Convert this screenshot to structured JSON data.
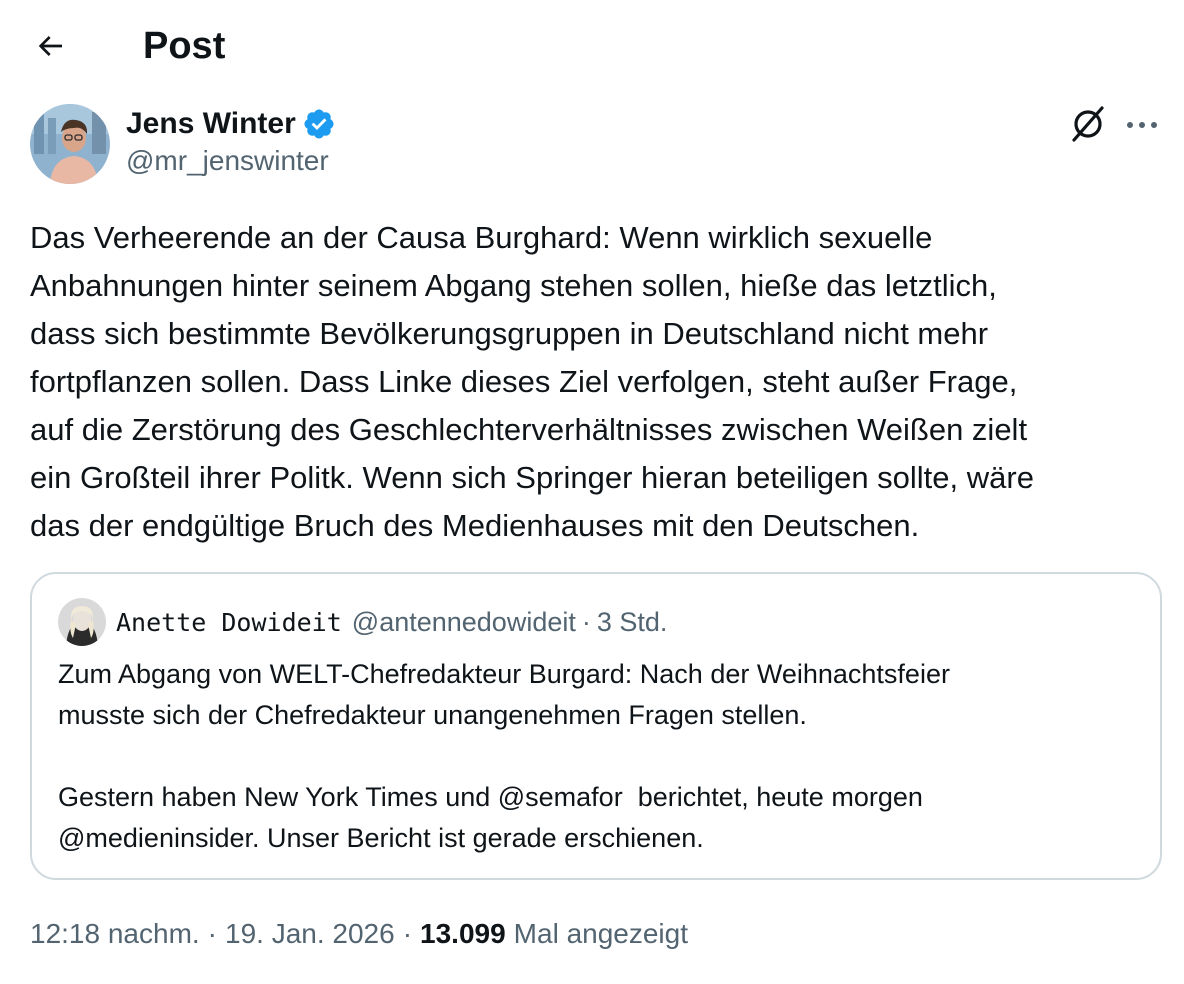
{
  "header": {
    "title": "Post",
    "back_icon": "arrow-left-icon"
  },
  "author": {
    "name": "Jens Winter",
    "handle": "@mr_jenswinter",
    "verified": true,
    "verified_color": "#1d9bf0"
  },
  "actions": {
    "grok_icon": "grok-icon",
    "more_icon": "more-horizontal-icon"
  },
  "tweet": {
    "lines": [
      "Das Verheerende an der Causa Burghard: Wenn wirklich sexuelle",
      "Anbahnungen hinter seinem Abgang stehen sollen, hieße das letztlich,",
      "dass sich bestimmte Bevölkerungsgruppen in Deutschland nicht mehr",
      "fortpflanzen sollen. Dass Linke dieses Ziel verfolgen, steht außer Frage,",
      "auf die Zerstörung des Geschlechterverhältnisses zwischen Weißen zielt",
      "ein Großteil ihrer Politk. Wenn sich Springer hieran beteiligen sollte, wäre",
      "das der endgültige Bruch des Medienhauses mit den Deutschen."
    ]
  },
  "quote": {
    "name": "Anette Dowideit",
    "handle": "@antennedowideit",
    "separator": "·",
    "time": "3 Std.",
    "paragraph1": [
      "Zum Abgang von WELT-Chefredakteur Burgard: Nach der Weihnachtsfeier",
      "musste sich der Chefredakteur unangenehmen Fragen stellen."
    ],
    "paragraph2": [
      "Gestern haben New York Times und @semafor  berichtet, heute morgen",
      "@medieninsider. Unser Bericht ist gerade erschienen."
    ]
  },
  "meta": {
    "time": "12:18 nachm.",
    "separator": "·",
    "date": "19. Jan. 2026",
    "views_count": "13.099",
    "views_label": "Mal angezeigt"
  },
  "colors": {
    "text_primary": "#0f1419",
    "text_secondary": "#536471",
    "border": "#cfd9de",
    "accent": "#1d9bf0"
  }
}
